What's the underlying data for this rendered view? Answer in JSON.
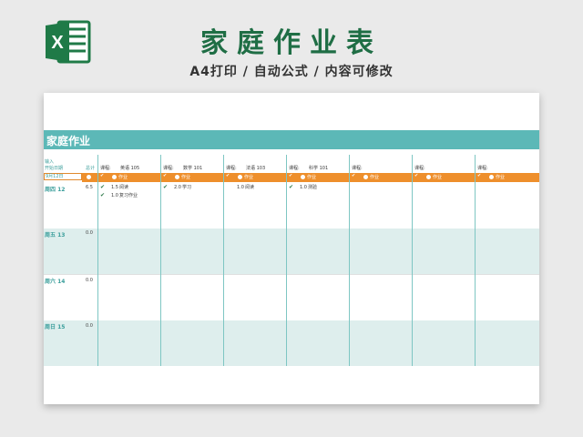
{
  "header": {
    "title": "家庭作业表",
    "subtitle": "A4打印 / 自动公式 / 内容可修改"
  },
  "sheet": {
    "band_title": "家庭作业",
    "input_label": "输入",
    "start_date_label": "开始日期",
    "start_date_value": "9月12日",
    "total_label": "总计",
    "course_label": "课程:",
    "homework_label": "作业",
    "courses": [
      "英语 105",
      "数学 101",
      "法语 103",
      "科学 101",
      "",
      "",
      ""
    ],
    "days": [
      {
        "label": "周四 12",
        "total": "6.5"
      },
      {
        "label": "周五 13",
        "total": "0.0"
      },
      {
        "label": "周六 14",
        "total": "0.0"
      },
      {
        "label": "周日 15",
        "total": "0.0"
      }
    ],
    "entries": [
      {
        "hours": "1.5",
        "task": "阅读"
      },
      {
        "hours": "1.0",
        "task": "复习作业"
      },
      {
        "hours": "2.0",
        "task": "学习"
      },
      {
        "hours": "1.0",
        "task": "阅读"
      },
      {
        "hours": "1.0",
        "task": "测验"
      }
    ]
  },
  "icons": {
    "check": "check-icon",
    "hours": "clock-icon",
    "excel": "excel-icon"
  },
  "colors": {
    "brand_green": "#1f6e45",
    "band_teal": "#5cb8b7",
    "header_orange": "#ee8f2c",
    "alt_row": "#deeeed"
  }
}
